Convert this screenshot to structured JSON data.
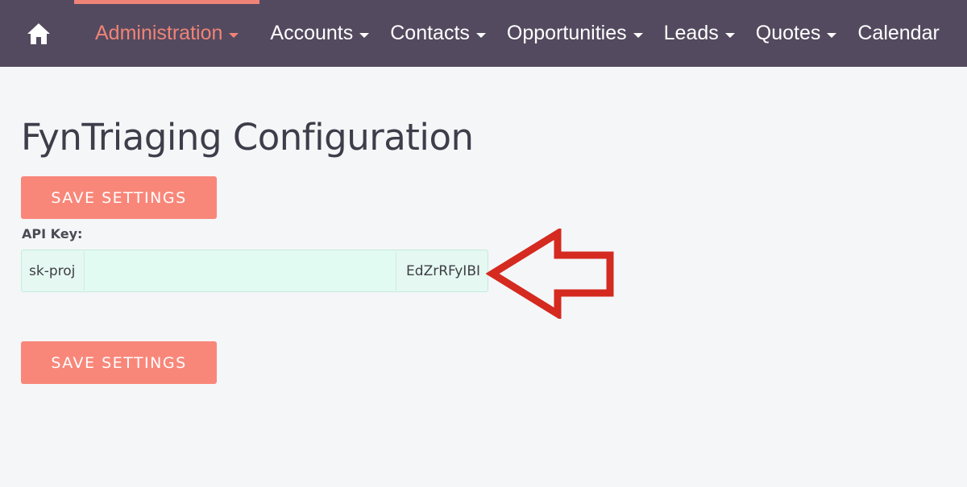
{
  "navbar": {
    "home_icon": "home-icon",
    "items": [
      {
        "label": "Administration",
        "active": true
      },
      {
        "label": "Accounts",
        "active": false
      },
      {
        "label": "Contacts",
        "active": false
      },
      {
        "label": "Opportunities",
        "active": false
      },
      {
        "label": "Leads",
        "active": false
      },
      {
        "label": "Quotes",
        "active": false
      },
      {
        "label": "Calendar",
        "active": false
      }
    ]
  },
  "page": {
    "title": "FynTriaging Configuration",
    "save_label_top": "SAVE SETTINGS",
    "save_label_bottom": "SAVE SETTINGS"
  },
  "api_key": {
    "label": "API Key:",
    "prefix": "sk-proj",
    "suffix": "EdZrRFyIBI"
  },
  "annotation": {
    "arrow_icon": "arrow-left-outline-icon",
    "color": "#d42a20"
  },
  "colors": {
    "navbar_bg": "#534a5f",
    "accent": "#f08377",
    "button_bg": "#f8877a",
    "field_bg": "#e5f8f1",
    "page_bg": "#f5f6f8"
  }
}
